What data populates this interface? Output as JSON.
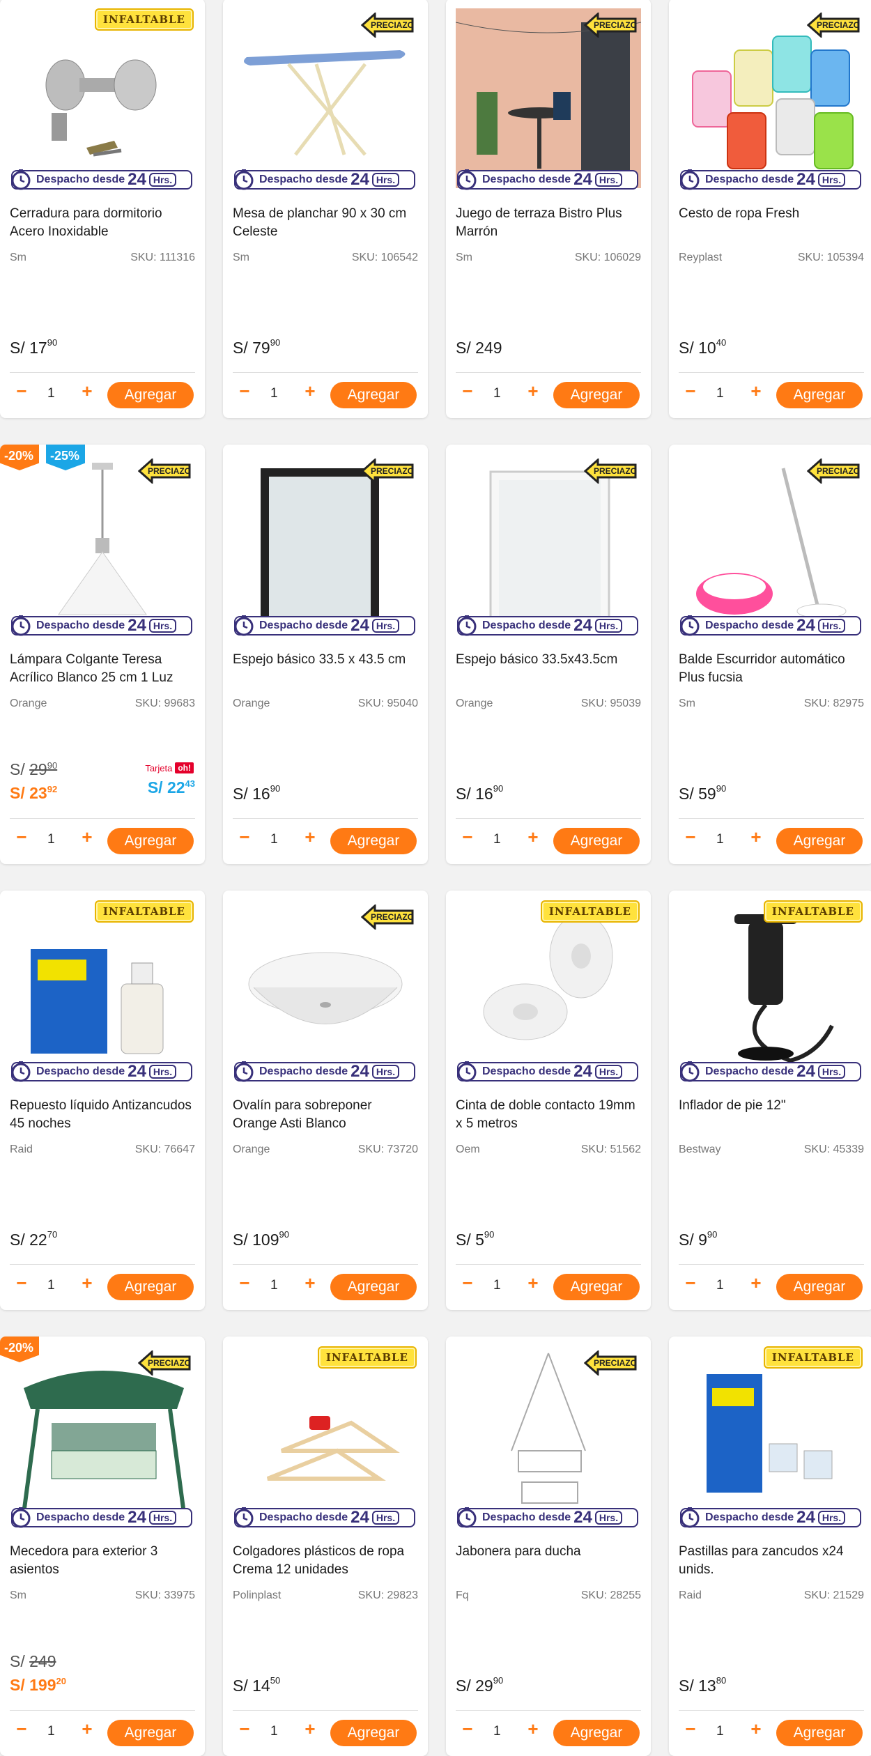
{
  "despacho": {
    "label": "Despacho desde",
    "num": "24",
    "hrs": "Hrs."
  },
  "badges": {
    "infaltable": "INFALTABLE",
    "preciazo": "PRECIAZO"
  },
  "add_label": "Agregar",
  "qty_minus": "−",
  "qty_plus": "+",
  "currency": "S/",
  "tarjeta_label": "Tarjeta",
  "oh_label": "oh!",
  "colors": {
    "accent": "#ff7a14",
    "despacho": "#38307a",
    "tarjeta": "#1ba6e6",
    "oh": "#e4002b"
  },
  "products": [
    {
      "title": "Cerradura para dormitorio Acero Inoxidable",
      "brand": "Sm",
      "sku": "SKU: 111316",
      "price_int": "17",
      "price_dec": "90",
      "badge": "infaltable",
      "icon": "door-knob-image",
      "qty": "1"
    },
    {
      "title": "Mesa de planchar 90 x 30 cm Celeste",
      "brand": "Sm",
      "sku": "SKU: 106542",
      "price_int": "79",
      "price_dec": "90",
      "badge": "preciazo",
      "icon": "ironing-board-image",
      "qty": "1"
    },
    {
      "title": "Juego de terraza Bistro Plus Marrón",
      "brand": "Sm",
      "sku": "SKU: 106029",
      "price_int": "249",
      "price_dec": "",
      "badge": "preciazo",
      "icon": "terrace-set-image",
      "qty": "1"
    },
    {
      "title": "Cesto de ropa Fresh",
      "brand": "Reyplast",
      "sku": "SKU: 105394",
      "price_int": "10",
      "price_dec": "40",
      "badge": "preciazo",
      "icon": "laundry-baskets-image",
      "qty": "1"
    },
    {
      "title": "Lámpara Colgante Teresa Acrílico Blanco 25 cm 1 Luz",
      "brand": "Orange",
      "sku": "SKU: 99683",
      "old_int": "29",
      "old_dec": "90",
      "sale_int": "23",
      "sale_dec": "92",
      "tarjeta_int": "22",
      "tarjeta_dec": "43",
      "disc1": "-20%",
      "disc2": "-25%",
      "badge": "preciazo",
      "icon": "pendant-lamp-image",
      "qty": "1"
    },
    {
      "title": "Espejo básico 33.5 x 43.5 cm",
      "brand": "Orange",
      "sku": "SKU: 95040",
      "price_int": "16",
      "price_dec": "90",
      "badge": "preciazo",
      "icon": "black-mirror-image",
      "qty": "1"
    },
    {
      "title": "Espejo básico 33.5x43.5cm",
      "brand": "Orange",
      "sku": "SKU: 95039",
      "price_int": "16",
      "price_dec": "90",
      "badge": "preciazo",
      "icon": "white-mirror-image",
      "qty": "1"
    },
    {
      "title": "Balde Escurridor automático Plus fucsia",
      "brand": "Sm",
      "sku": "SKU: 82975",
      "price_int": "59",
      "price_dec": "90",
      "badge": "preciazo",
      "icon": "mop-bucket-image",
      "qty": "1"
    },
    {
      "title": "Repuesto líquido Antizancudos 45 noches",
      "brand": "Raid",
      "sku": "SKU: 76647",
      "price_int": "22",
      "price_dec": "70",
      "badge": "infaltable",
      "icon": "raid-refill-image",
      "qty": "1"
    },
    {
      "title": "Ovalín para sobreponer Orange Asti Blanco",
      "brand": "Orange",
      "sku": "SKU: 73720",
      "price_int": "109",
      "price_dec": "90",
      "badge": "preciazo",
      "icon": "sink-bowl-image",
      "qty": "1"
    },
    {
      "title": "Cinta de doble contacto 19mm x 5 metros",
      "brand": "Oem",
      "sku": "SKU: 51562",
      "price_int": "5",
      "price_dec": "90",
      "badge": "infaltable",
      "icon": "tape-rolls-image",
      "qty": "1"
    },
    {
      "title": "Inflador de pie 12\"",
      "brand": "Bestway",
      "sku": "SKU: 45339",
      "price_int": "9",
      "price_dec": "90",
      "badge": "infaltable",
      "icon": "air-pump-image",
      "qty": "1"
    },
    {
      "title": "Mecedora para exterior 3 asientos",
      "brand": "Sm",
      "sku": "SKU: 33975",
      "old_int": "249",
      "old_dec": "",
      "sale_int": "199",
      "sale_dec": "20",
      "disc1": "-20%",
      "badge": "preciazo",
      "icon": "garden-swing-image",
      "qty": "1"
    },
    {
      "title": "Colgadores plásticos de ropa Crema 12 unidades",
      "brand": "Polinplast",
      "sku": "SKU: 29823",
      "price_int": "14",
      "price_dec": "50",
      "badge": "infaltable",
      "icon": "hangers-image",
      "qty": "1"
    },
    {
      "title": "Jabonera para ducha",
      "brand": "Fq",
      "sku": "SKU: 28255",
      "price_int": "29",
      "price_dec": "90",
      "badge": "preciazo",
      "icon": "shower-caddy-image",
      "qty": "1"
    },
    {
      "title": "Pastillas para zancudos x24 unids.",
      "brand": "Raid",
      "sku": "SKU: 21529",
      "price_int": "13",
      "price_dec": "80",
      "badge": "infaltable",
      "icon": "raid-tablets-image",
      "qty": "1"
    }
  ]
}
